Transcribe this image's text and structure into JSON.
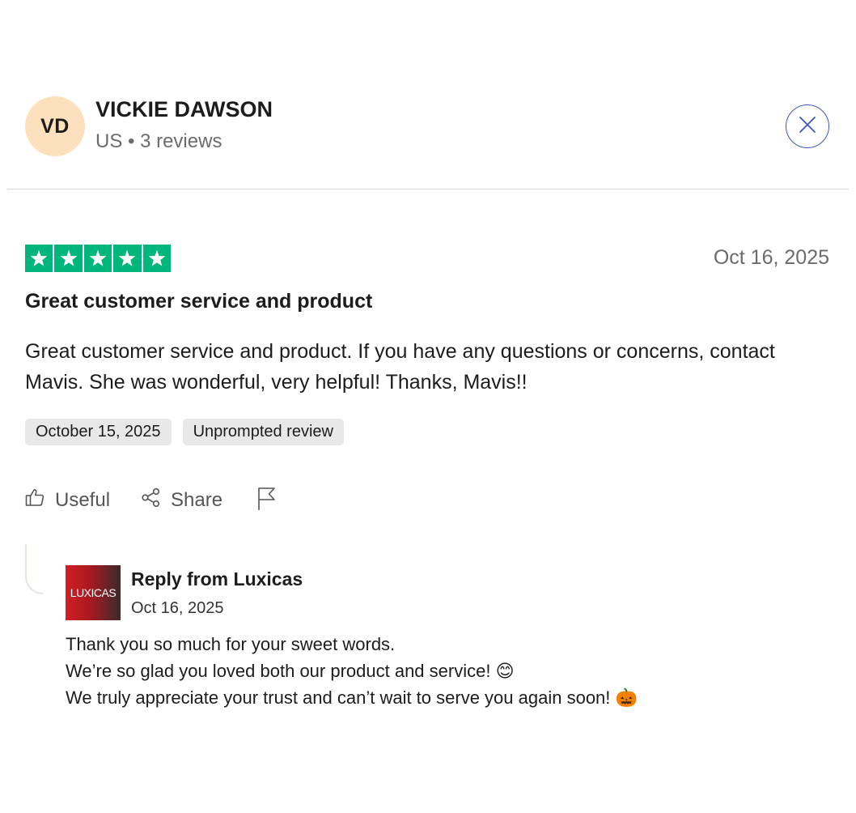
{
  "reviewer": {
    "initials": "VD",
    "name": "VICKIE DAWSON",
    "meta": "US • 3 reviews"
  },
  "icons": {
    "close": "close-icon",
    "star": "star-icon",
    "useful": "thumbs-up-icon",
    "share": "share-icon",
    "flag": "flag-icon"
  },
  "colors": {
    "star_green": "#00b67a",
    "avatar_bg": "#fde0bd",
    "close_border": "#3c57bc",
    "tag_bg": "#e8e8e8"
  },
  "review": {
    "rating": 5,
    "rating_max": 5,
    "date": "Oct 16, 2025",
    "title": "Great customer service and product",
    "body": "Great customer service and product. If you have any questions or concerns, contact Mavis. She was wonderful, very helpful! Thanks, Mavis!!",
    "tags": [
      "October 15, 2025",
      "Unprompted review"
    ]
  },
  "actions": {
    "useful_label": "Useful",
    "share_label": "Share"
  },
  "reply": {
    "company_logo_text": "LUXICAS",
    "title": "Reply from Luxicas",
    "date": "Oct 16, 2025",
    "lines": [
      "Thank you so much for your sweet words.",
      "We’re so glad you loved both our product and service! 😊",
      "We truly appreciate your trust and can’t wait to serve you again soon! 🎃"
    ]
  }
}
